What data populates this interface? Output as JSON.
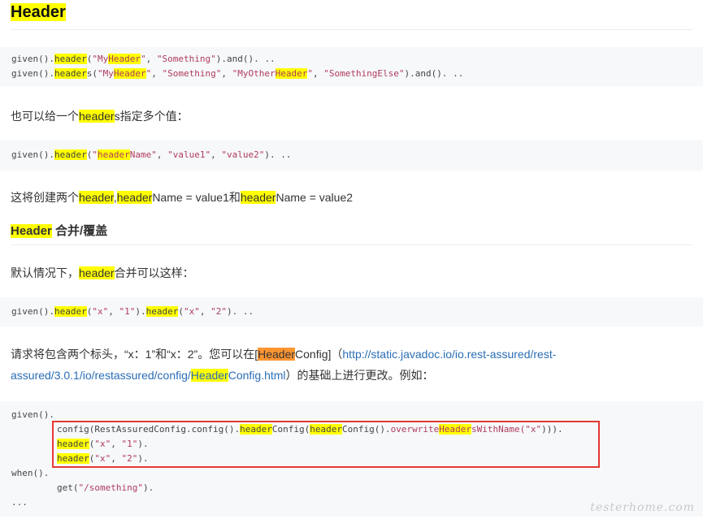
{
  "heading_main": "Header",
  "code1": {
    "line1": [
      "given().",
      "header",
      "(",
      "\"My",
      "Header",
      "\"",
      ", ",
      "\"Something\"",
      ").and(). .."
    ],
    "line2": [
      "given().",
      "header",
      "s(",
      "\"My",
      "Header",
      "\"",
      ", ",
      "\"Something\"",
      ", ",
      "\"MyOther",
      "Header",
      "\"",
      ", ",
      "\"SomethingElse\"",
      ").and(). .."
    ]
  },
  "para1": [
    "也可以给一个",
    "header",
    "s指定多个值："
  ],
  "code2": [
    "given().",
    "header",
    "(",
    "\"",
    "header",
    "Name\"",
    ", ",
    "\"value1\"",
    ", ",
    "\"value2\"",
    "). .."
  ],
  "para2": [
    "这将创建两个",
    "header",
    ",",
    "header",
    "Name = value1和",
    "header",
    "Name = value2"
  ],
  "heading_sub": [
    "Header",
    " 合并/覆盖"
  ],
  "para3": [
    "默认情况下，",
    "header",
    "合并可以这样："
  ],
  "code3": [
    "given().",
    "header",
    "(",
    "\"x\"",
    ", ",
    "\"1\"",
    ").",
    "header",
    "(",
    "\"x\"",
    ", ",
    "\"2\"",
    "). .."
  ],
  "para4": {
    "line1_a": "请求将包含两个标头，“x：1”和“x：2”。您可以在[",
    "line1_hl": "Header",
    "line1_b": "Config]（",
    "link_part1": "http://static.javadoc.io/io.rest-assured/rest-",
    "link_part2a": "assured/3.0.1/io/restassured/config/",
    "link_hl": "Header",
    "link_part2b": "Config.html",
    "line2_c": "）的基础上进行更改。例如："
  },
  "code4": {
    "l1": "given().",
    "l2": [
      "config(RestAssuredConfig.config().",
      "header",
      "Config(",
      "header",
      "Config().",
      "overwrite",
      "Header",
      "sWithName(",
      "\"x\"",
      ")))."
    ],
    "l3": [
      "header",
      "(",
      "\"x\"",
      ", ",
      "\"1\"",
      ")."
    ],
    "l4": [
      "header",
      "(",
      "\"x\"",
      ", ",
      "\"2\"",
      ")."
    ],
    "l5": "when().",
    "l6": [
      "get(",
      "\"/something\"",
      ")."
    ],
    "l7": "..."
  },
  "watermark": "testerhome.com",
  "colors": {
    "highlight": "#ffff00",
    "highlight_orange": "#ff9632",
    "link": "#2a6db5",
    "red_box": "#e53935",
    "code_bg": "#f6f8fa",
    "string": "#b03b5d"
  }
}
